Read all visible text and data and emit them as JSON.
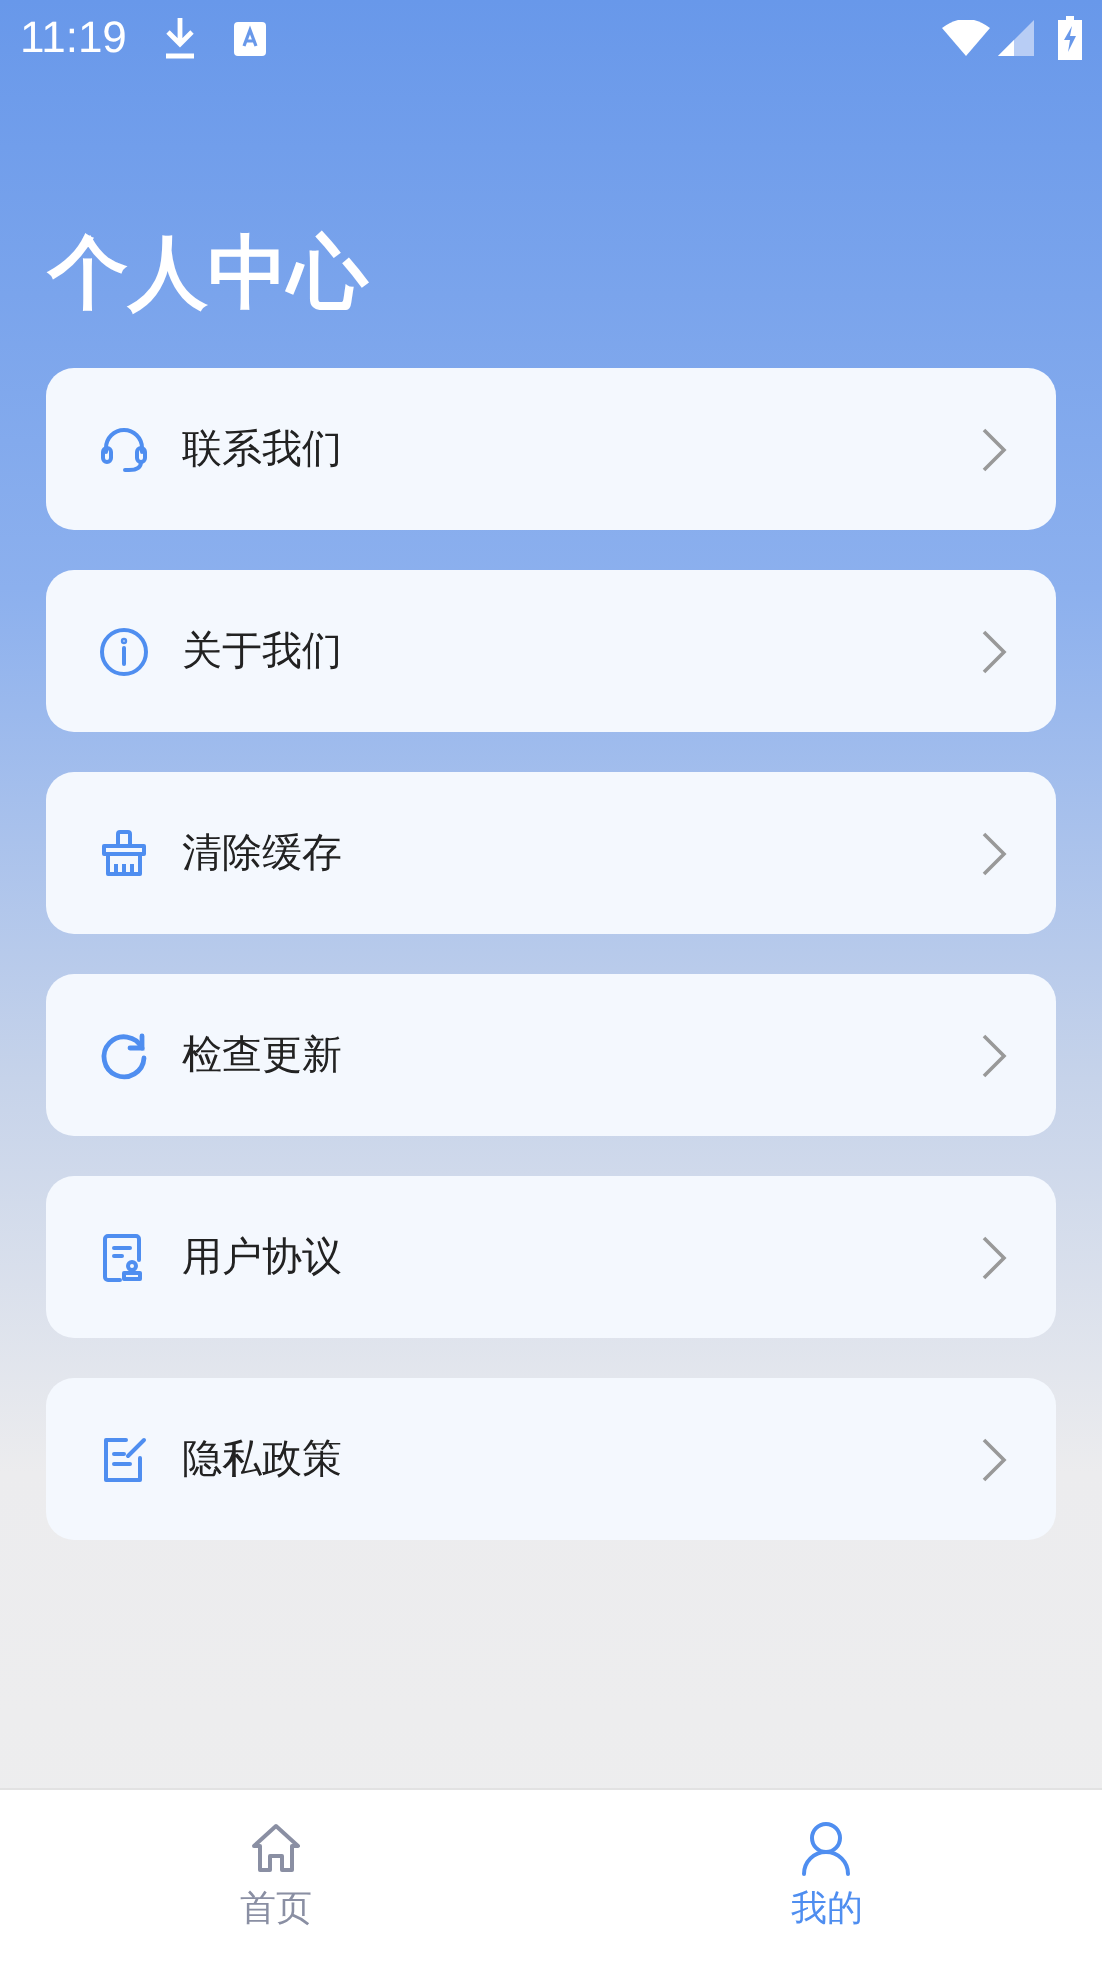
{
  "status_bar": {
    "time": "11:19"
  },
  "title": "个人中心",
  "menu": [
    {
      "label": "联系我们",
      "kind": "headset"
    },
    {
      "label": "关于我们",
      "kind": "info"
    },
    {
      "label": "清除缓存",
      "kind": "broom"
    },
    {
      "label": "检查更新",
      "kind": "refresh"
    },
    {
      "label": "用户协议",
      "kind": "document"
    },
    {
      "label": "隐私政策",
      "kind": "edit"
    }
  ],
  "tabs": [
    {
      "label": "首页",
      "kind": "home",
      "selected": false
    },
    {
      "label": "我的",
      "kind": "person",
      "selected": true
    }
  ]
}
